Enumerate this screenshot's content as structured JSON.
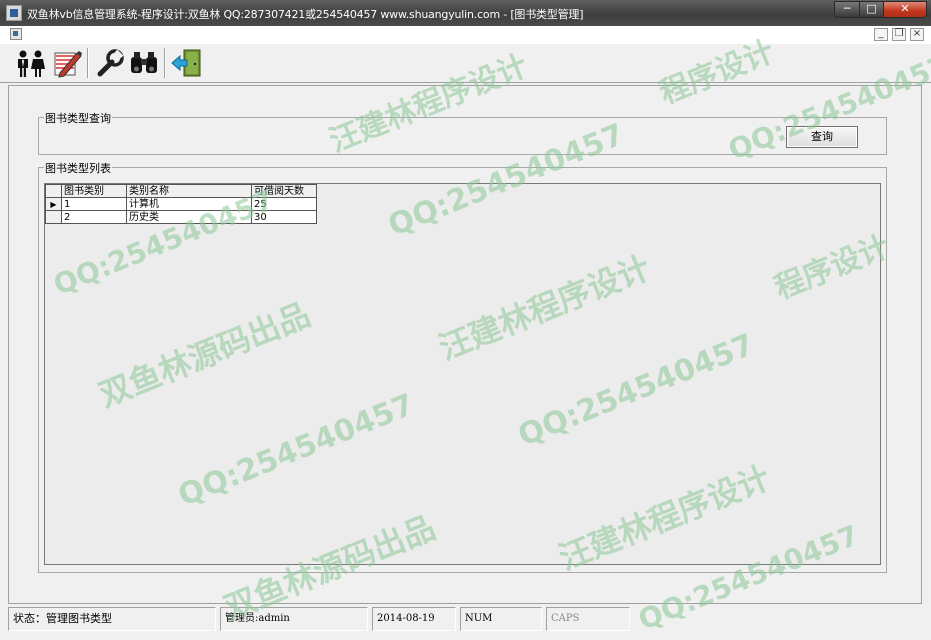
{
  "window": {
    "title": "双鱼林vb信息管理系统-程序设计:双鱼林 QQ:287307421或254540457 www.shuangyulin.com - [图书类型管理]",
    "minimize_glyph": "─",
    "maximize_glyph": "□",
    "close_glyph": "✕"
  },
  "mdi": {
    "min_glyph": "_",
    "restore_glyph": "❐",
    "close_glyph": "×"
  },
  "toolbar": {
    "icons": [
      "users-icon",
      "edit-document-icon",
      "wrench-icon",
      "binoculars-icon",
      "exit-door-icon"
    ]
  },
  "query_group": {
    "label": "图书类型查询",
    "button_label": "查询"
  },
  "list_group": {
    "label": "图书类型列表"
  },
  "grid": {
    "columns": [
      "图书类别",
      "类别名称",
      "可借阅天数"
    ],
    "rows": [
      [
        "1",
        "计算机",
        "25"
      ],
      [
        "2",
        "历史类",
        "30"
      ]
    ],
    "selected_row_marker": "▶"
  },
  "statusbar": {
    "status": "状态：管理图书类型",
    "user": "管理员:admin",
    "date": "2014-08-19",
    "num": "NUM",
    "caps": "CAPS"
  },
  "watermarks": {
    "qq": "QQ:254540457",
    "designer": "汪建林程序设计",
    "source": "双鱼林源码出品",
    "design_short": "程序设计"
  },
  "colors": {
    "titlebar": "#4a4a4a",
    "close_button": "#c1361f",
    "watermark": "#8cc896",
    "window_bg": "#f0f0f0"
  }
}
